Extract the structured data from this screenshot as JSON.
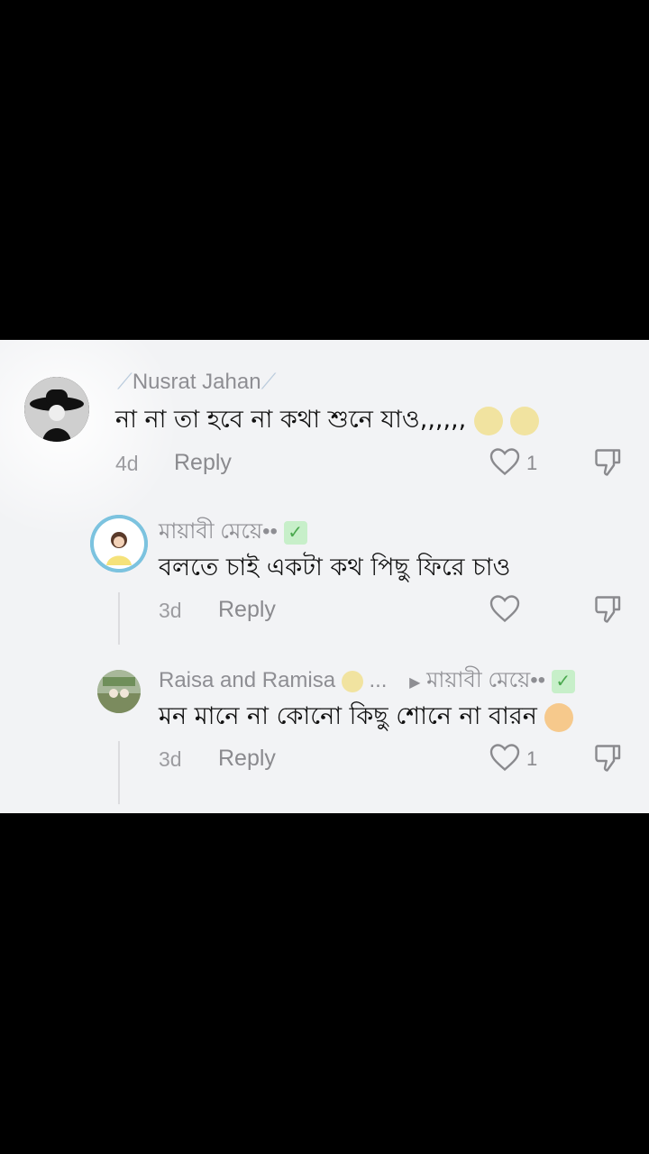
{
  "comments": [
    {
      "name": "Nusrat Jahan",
      "text": "না না তা হবে না কথা শুনে যাও,,,,,, ",
      "time": "4d",
      "reply": "Reply",
      "likes": "1"
    },
    {
      "name": "মায়াবী মেয়ে••",
      "text": "বলতে চাই একটা কথ পিছু ফিরে চাও",
      "time": "3d",
      "reply": "Reply",
      "likes": ""
    },
    {
      "name": "Raisa and Ramisa",
      "name_suffix": "...",
      "reply_to": "মায়াবী মেয়ে••",
      "text": "মন মানে না কোনো কিছু শোনে না বারন ",
      "time": "3d",
      "reply": "Reply",
      "likes": "1"
    }
  ],
  "colors": {
    "background": "#f2f3f5",
    "muted": "#8e8e93",
    "text": "#111111",
    "letterbox": "#000000"
  },
  "icons": [
    "heart-icon",
    "dislike-icon",
    "verified-icon",
    "pen-icon",
    "reply-arrow-icon"
  ]
}
